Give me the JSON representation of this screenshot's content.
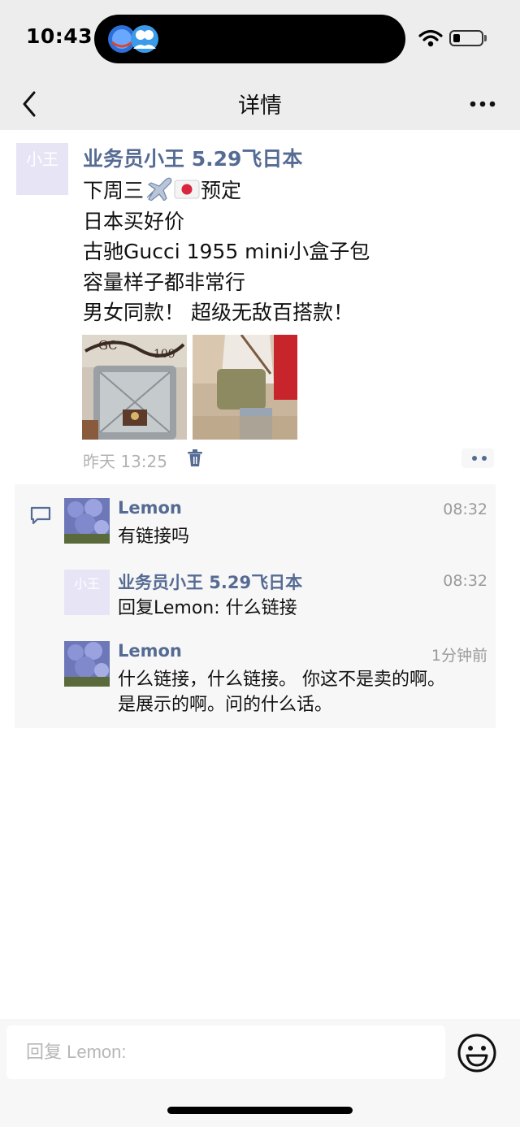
{
  "status_bar": {
    "time": "10:43"
  },
  "nav": {
    "title": "详情",
    "back_icon": "chevron-left-icon",
    "more_icon": "more-dots-icon"
  },
  "post": {
    "avatar_text": "小王",
    "author": "业务员小王 5.29飞日本",
    "lines": [
      {
        "before": "下周三",
        "after": "预定"
      },
      {
        "text": "日本买好价"
      },
      {
        "text": "古驰Gucci 1955 mini小盒子包"
      },
      {
        "text": "容量样子都非常行"
      },
      {
        "text": "男女同款！   超级无敌百搭款！"
      }
    ],
    "emoji": [
      "airplane-emoji",
      "japan-flag-emoji"
    ],
    "timestamp": "昨天 13:25",
    "delete_icon": "trash-icon",
    "comment_toggle_icon": "more-dots-icon"
  },
  "comments": [
    {
      "name": "Lemon",
      "time": "08:32",
      "text": "有链接吗",
      "avatar": "hydrangea-photo"
    },
    {
      "name": "业务员小王 5.29飞日本",
      "time": "08:32",
      "text": "回复Lemon: 什么链接",
      "avatar_text": "小王"
    },
    {
      "name": "Lemon",
      "time": "1分钟前",
      "text_lines": [
        "什么链接，什么链接。 你这不是卖的啊。",
        "是展示的啊。问的什么话。"
      ],
      "avatar": "hydrangea-photo"
    }
  ],
  "input": {
    "placeholder": "回复 Lemon:",
    "emoji_icon": "emoji-face-icon"
  },
  "colors": {
    "name_link": "#566b94",
    "header_bg": "#ededed",
    "comment_bg": "#f7f7f7",
    "timestamp": "#b2b2b2"
  }
}
